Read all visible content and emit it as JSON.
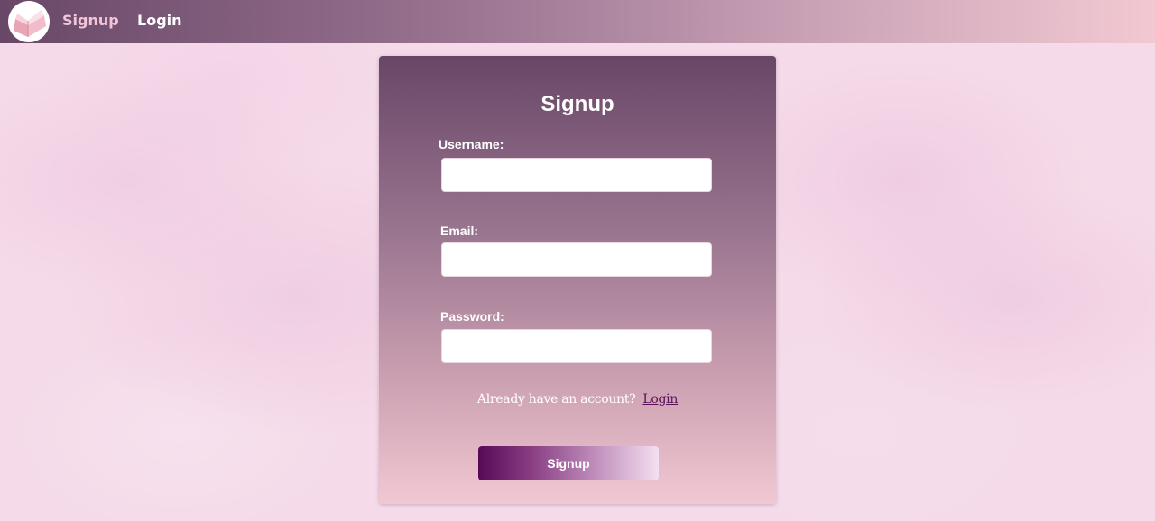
{
  "nav": {
    "signup_label": "Signup",
    "login_label": "Login"
  },
  "form": {
    "title": "Signup",
    "username_label": "Username:",
    "username_value": "",
    "email_label": "Email:",
    "email_value": "",
    "password_label": "Password:",
    "password_value": "",
    "account_prompt": "Already have an account?",
    "login_link": "Login",
    "submit_label": "Signup"
  },
  "colors": {
    "nav_start": "#684767",
    "nav_end": "#f2c9d2",
    "card_top": "#684667",
    "card_bottom": "#f1c8d2",
    "active_nav": "#f2c6d8",
    "link": "#5a0f57",
    "button_start": "#560a56",
    "button_end": "#f4dff1"
  },
  "icons": {
    "logo": "open-book-icon"
  }
}
